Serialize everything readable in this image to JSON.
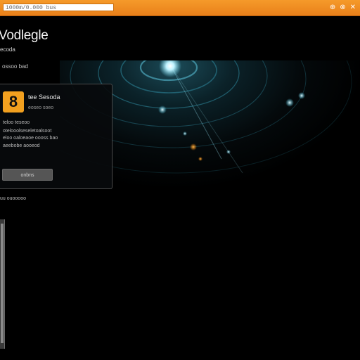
{
  "topbar": {
    "address": "1000m/0.000 bus",
    "controls": [
      "⊕",
      "⊗",
      "✕"
    ],
    "control_icons": [
      "settings-icon",
      "help-icon",
      "close-icon"
    ]
  },
  "header": {
    "title": "Vodlegle",
    "subtitle": "ecoda"
  },
  "section": {
    "label": "ossoo bad"
  },
  "card": {
    "logo_glyph": "8",
    "title": "tee Sesoda",
    "subtitle": "eoseo soeo",
    "lines": [
      "teloo teseoo",
      "otelooolseseletoalsoot",
      "eloo oaloeaoe oooss bao",
      "aeebobe aooeod"
    ],
    "button_label": "onbns"
  },
  "below_label": "uu ouooooo",
  "colors": {
    "accent": "#f2a01f",
    "hero_glow": "#6fd8f0",
    "background": "#000000"
  }
}
